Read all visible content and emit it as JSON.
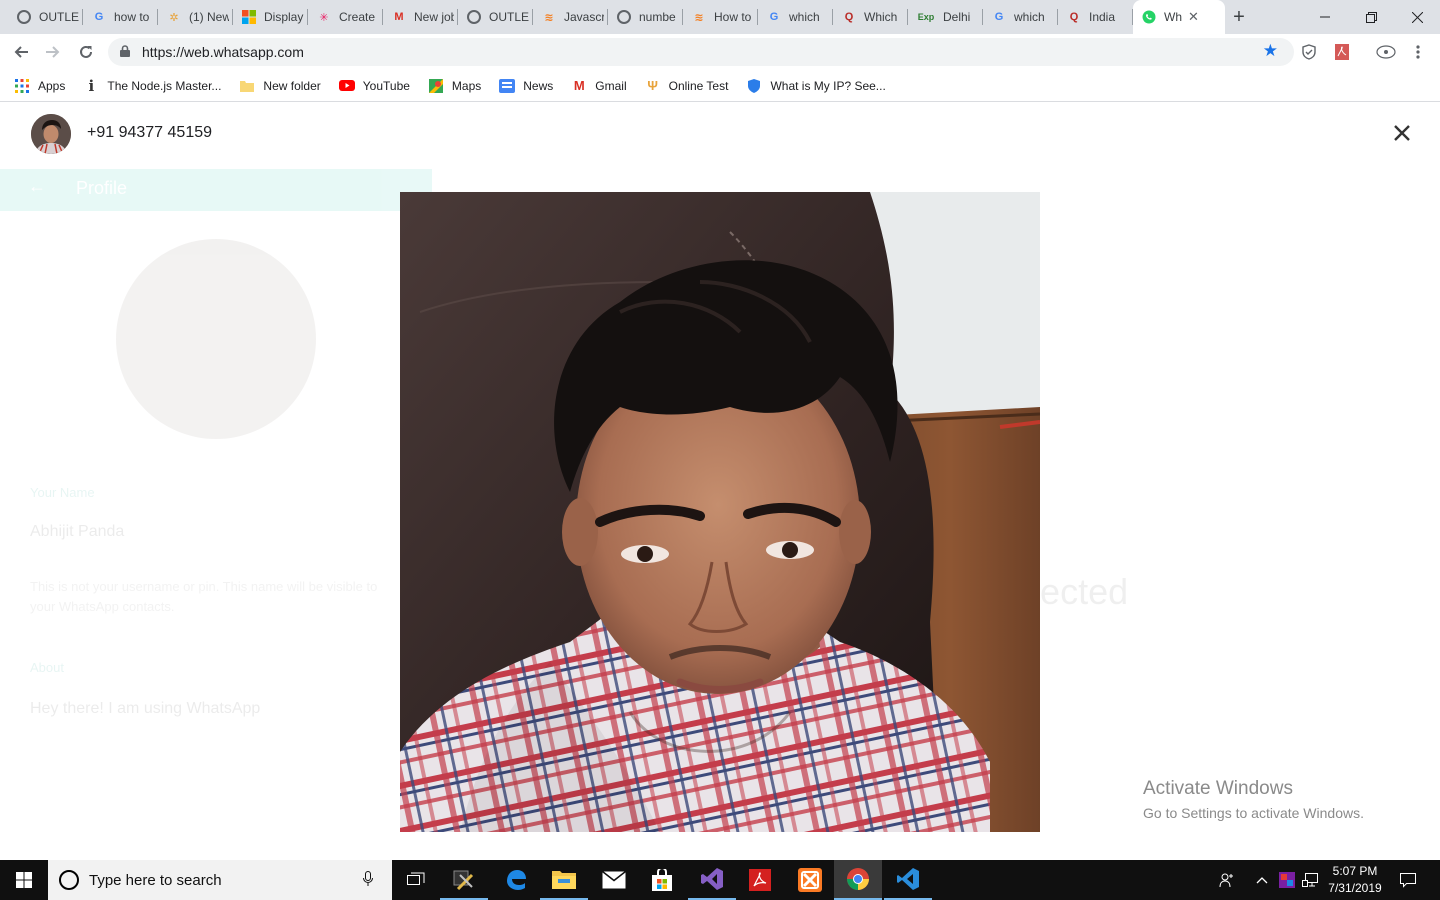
{
  "browser": {
    "tabs": [
      {
        "label": "OUTLE",
        "icon": "globe-icon",
        "color": "#5f6368"
      },
      {
        "label": "how to",
        "icon": "google-icon",
        "color": "#4285f4"
      },
      {
        "label": "(1) New",
        "icon": "pinwheel-icon",
        "color": "#e8a33b"
      },
      {
        "label": "Display",
        "icon": "windows-logo-icon",
        "color": "#f25022"
      },
      {
        "label": "Create",
        "icon": "sparkle-icon",
        "color": "#e91e63"
      },
      {
        "label": "New job",
        "icon": "gmail-icon",
        "color": "#d93025"
      },
      {
        "label": "OUTLE",
        "icon": "globe-icon",
        "color": "#5f6368"
      },
      {
        "label": "Javascr",
        "icon": "stackoverflow-icon",
        "color": "#f48024"
      },
      {
        "label": "numbe",
        "icon": "globe-icon",
        "color": "#5f6368"
      },
      {
        "label": "How to",
        "icon": "stackoverflow-icon",
        "color": "#f48024"
      },
      {
        "label": "which",
        "icon": "google-icon",
        "color": "#4285f4"
      },
      {
        "label": "Which",
        "icon": "quora-icon",
        "color": "#b92b27"
      },
      {
        "label": "Delhi",
        "icon": "exp-icon",
        "color": "#2e7d32"
      },
      {
        "label": "which",
        "icon": "google-icon",
        "color": "#4285f4"
      },
      {
        "label": "India",
        "icon": "quora-icon",
        "color": "#b92b27"
      }
    ],
    "active_tab": {
      "label": "Wh",
      "icon": "whatsapp-icon",
      "color": "#25d366"
    },
    "url": "https://web.whatsapp.com",
    "bookmarks": [
      {
        "label": "Apps",
        "icon": "apps-grid-icon"
      },
      {
        "label": "The Node.js Master...",
        "icon": "info-icon"
      },
      {
        "label": "New folder",
        "icon": "folder-icon"
      },
      {
        "label": "YouTube",
        "icon": "youtube-icon"
      },
      {
        "label": "Maps",
        "icon": "maps-icon"
      },
      {
        "label": "News",
        "icon": "news-icon"
      },
      {
        "label": "Gmail",
        "icon": "gmail-icon"
      },
      {
        "label": "Online Test",
        "icon": "online-test-icon"
      },
      {
        "label": "What is My IP? See...",
        "icon": "shield-icon"
      }
    ]
  },
  "media_viewer": {
    "contact": "+91 94377 45159"
  },
  "background_profile": {
    "header": "Profile",
    "name_label": "Your Name",
    "name_value": "Abhijit Panda",
    "name_note": "This is not your username or pin. This name will be visible to your WhatsApp contacts.",
    "about_label": "About",
    "about_value": "Hey there! I am using WhatsApp",
    "connected_text": "nnected"
  },
  "watermark": {
    "title": "Activate Windows",
    "subtitle": "Go to Settings to activate Windows."
  },
  "taskbar": {
    "search_placeholder": "Type here to search",
    "time": "5:07 PM",
    "date": "7/31/2019"
  },
  "colors": {
    "whatsapp_teal": "#00bfa5",
    "chrome_blue": "#1a73e8",
    "taskbar_accent": "#76b9ed"
  }
}
